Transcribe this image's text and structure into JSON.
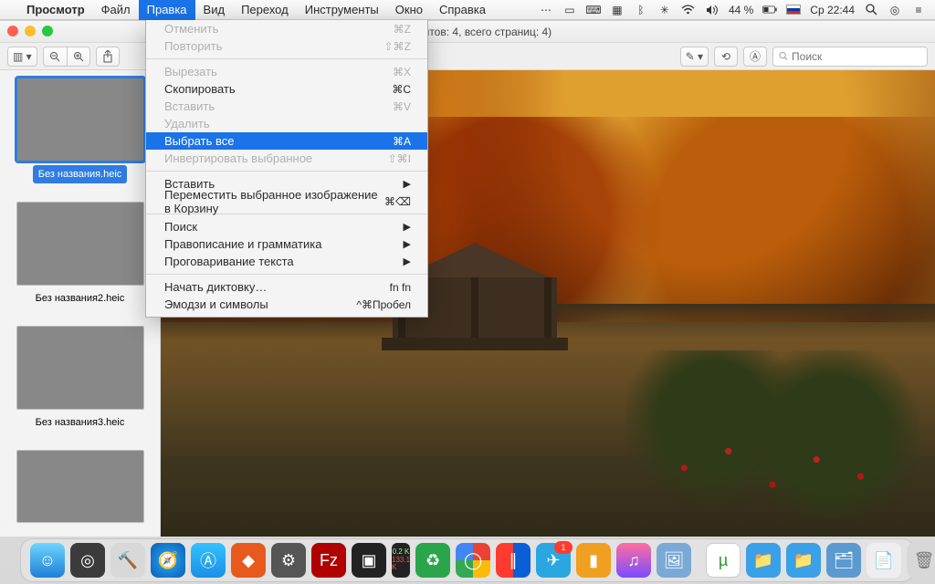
{
  "menubar": {
    "app": "Просмотр",
    "items": [
      "Файл",
      "Правка",
      "Вид",
      "Переход",
      "Инструменты",
      "Окно",
      "Справка"
    ],
    "active_index": 1,
    "right": {
      "battery": "44 %",
      "clock": "Ср 22:44"
    }
  },
  "dropdown": {
    "sections": [
      [
        {
          "label": "Отменить",
          "shortcut": "⌘Z",
          "disabled": true
        },
        {
          "label": "Повторить",
          "shortcut": "⇧⌘Z",
          "disabled": true
        }
      ],
      [
        {
          "label": "Вырезать",
          "shortcut": "⌘X",
          "disabled": true
        },
        {
          "label": "Скопировать",
          "shortcut": "⌘C",
          "disabled": false
        },
        {
          "label": "Вставить",
          "shortcut": "⌘V",
          "disabled": true
        },
        {
          "label": "Удалить",
          "shortcut": "",
          "disabled": true
        },
        {
          "label": "Выбрать все",
          "shortcut": "⌘A",
          "disabled": false,
          "highlight": true
        },
        {
          "label": "Инвертировать выбранное",
          "shortcut": "⇧⌘I",
          "disabled": true
        }
      ],
      [
        {
          "label": "Вставить",
          "shortcut": "",
          "disabled": false,
          "submenu": true
        },
        {
          "label": "Переместить выбранное изображение в Корзину",
          "shortcut": "⌘⌫",
          "disabled": false
        }
      ],
      [
        {
          "label": "Поиск",
          "shortcut": "",
          "disabled": false,
          "submenu": true
        },
        {
          "label": "Правописание и грамматика",
          "shortcut": "",
          "disabled": false,
          "submenu": true
        },
        {
          "label": "Проговаривание текста",
          "shortcut": "",
          "disabled": false,
          "submenu": true
        }
      ],
      [
        {
          "label": "Начать диктовку…",
          "shortcut": "fn fn",
          "disabled": false
        },
        {
          "label": "Эмодзи и символы",
          "shortcut": "^⌘Пробел",
          "disabled": false
        }
      ]
    ]
  },
  "window": {
    "title_suffix": "(документов: 4, всего страниц: 4)",
    "search_placeholder": "Поиск"
  },
  "sidebar": {
    "thumbs": [
      {
        "label": "Без названия.heic",
        "selected": true
      },
      {
        "label": "Без названия2.heic",
        "selected": false
      },
      {
        "label": "Без названия3.heic",
        "selected": false
      },
      {
        "label": "",
        "selected": false
      }
    ]
  },
  "dock": {
    "netmon_up": "0.2 K",
    "netmon_down": "133.1 K",
    "telegram_badge": "1"
  }
}
